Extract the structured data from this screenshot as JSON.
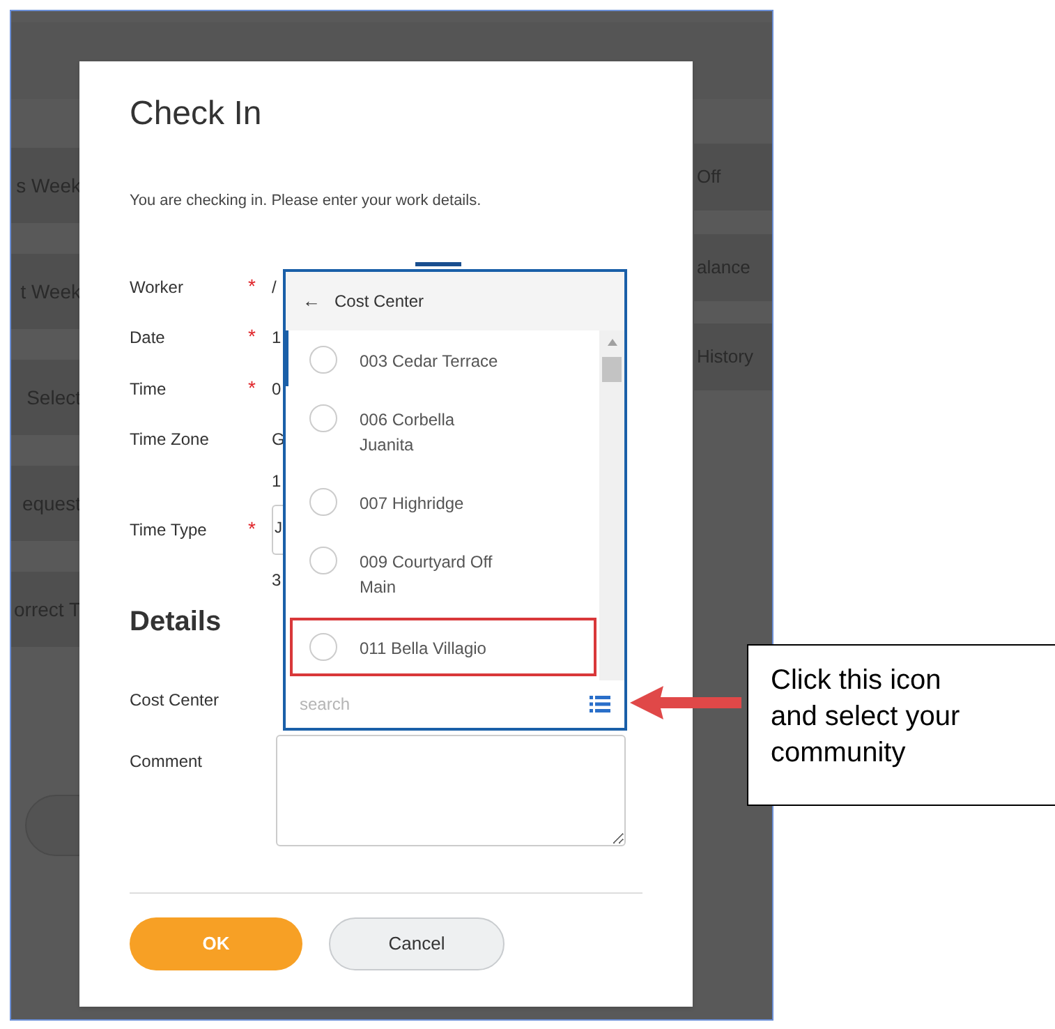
{
  "background": {
    "left_items": [
      "s Week",
      "t Week",
      "Select",
      "equest",
      "orrect T"
    ],
    "right_items": [
      "Off",
      "alance",
      "History"
    ]
  },
  "dialog": {
    "title": "Check In",
    "required_mark": "*",
    "message": "You are checking in.  Please enter your work details.",
    "fields": [
      {
        "label": "Worker",
        "required": true,
        "value": "/",
        "kind": "text"
      },
      {
        "label": "Date",
        "required": true,
        "value": "1",
        "kind": "text"
      },
      {
        "label": "Time",
        "required": true,
        "value": "0",
        "kind": "text"
      },
      {
        "label": "Time Zone",
        "required": false,
        "value": "G",
        "value_2": "1",
        "kind": "text"
      },
      {
        "label": "Time Type",
        "required": true,
        "value": "J",
        "value_2": "3",
        "kind": "select"
      }
    ],
    "section_title": "Details",
    "cost_center": {
      "label": "Cost Center"
    },
    "comment": {
      "label": "Comment"
    },
    "buttons": [
      {
        "label": "OK",
        "kind": "primary"
      },
      {
        "label": "Cancel",
        "kind": "secondary"
      }
    ]
  },
  "dropdown": {
    "back": "←",
    "title": "Cost Center",
    "options": [
      {
        "label": "003 Cedar Terrace",
        "selected": false,
        "highlighted": false
      },
      {
        "label": "006 Corbella Juanita",
        "selected": false,
        "highlighted": false
      },
      {
        "label": "007 Highridge",
        "selected": false,
        "highlighted": false
      },
      {
        "label": "009 Courtyard Off Main",
        "selected": false,
        "highlighted": false
      },
      {
        "label": "011 Bella Villagio",
        "selected": false,
        "highlighted": true
      }
    ],
    "search": {
      "placeholder": "search"
    }
  },
  "callout": {
    "text": "Click this icon and select your community"
  }
}
